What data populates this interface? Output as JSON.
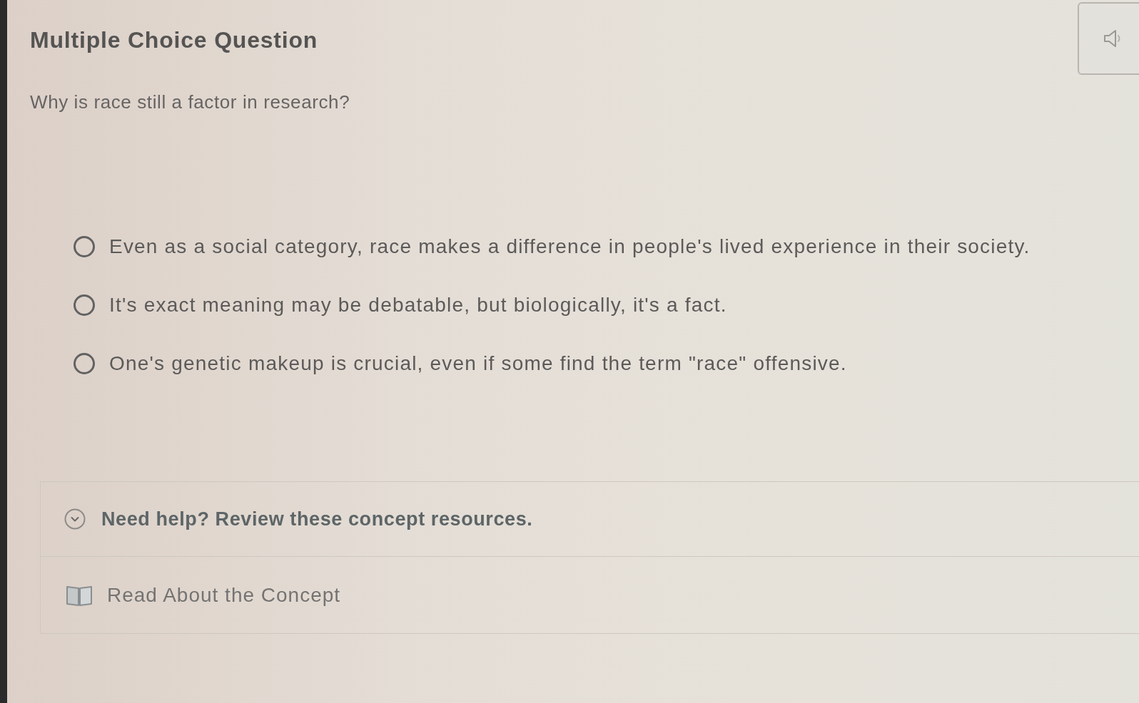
{
  "header": {
    "title": "Multiple Choice Question"
  },
  "question": "Why is race still a factor in research?",
  "options": [
    {
      "label": "Even as a social category, race makes a difference in people's lived experience in their society.",
      "selected": false
    },
    {
      "label": "It's exact meaning may be debatable, but biologically, it's a fact.",
      "selected": false
    },
    {
      "label": "One's genetic makeup is crucial, even if some find the term \"race\" offensive.",
      "selected": false
    }
  ],
  "help": {
    "title": "Need help? Review these concept resources.",
    "expanded": true,
    "resources": [
      {
        "kind": "reading",
        "label": "Read About the Concept"
      }
    ]
  }
}
